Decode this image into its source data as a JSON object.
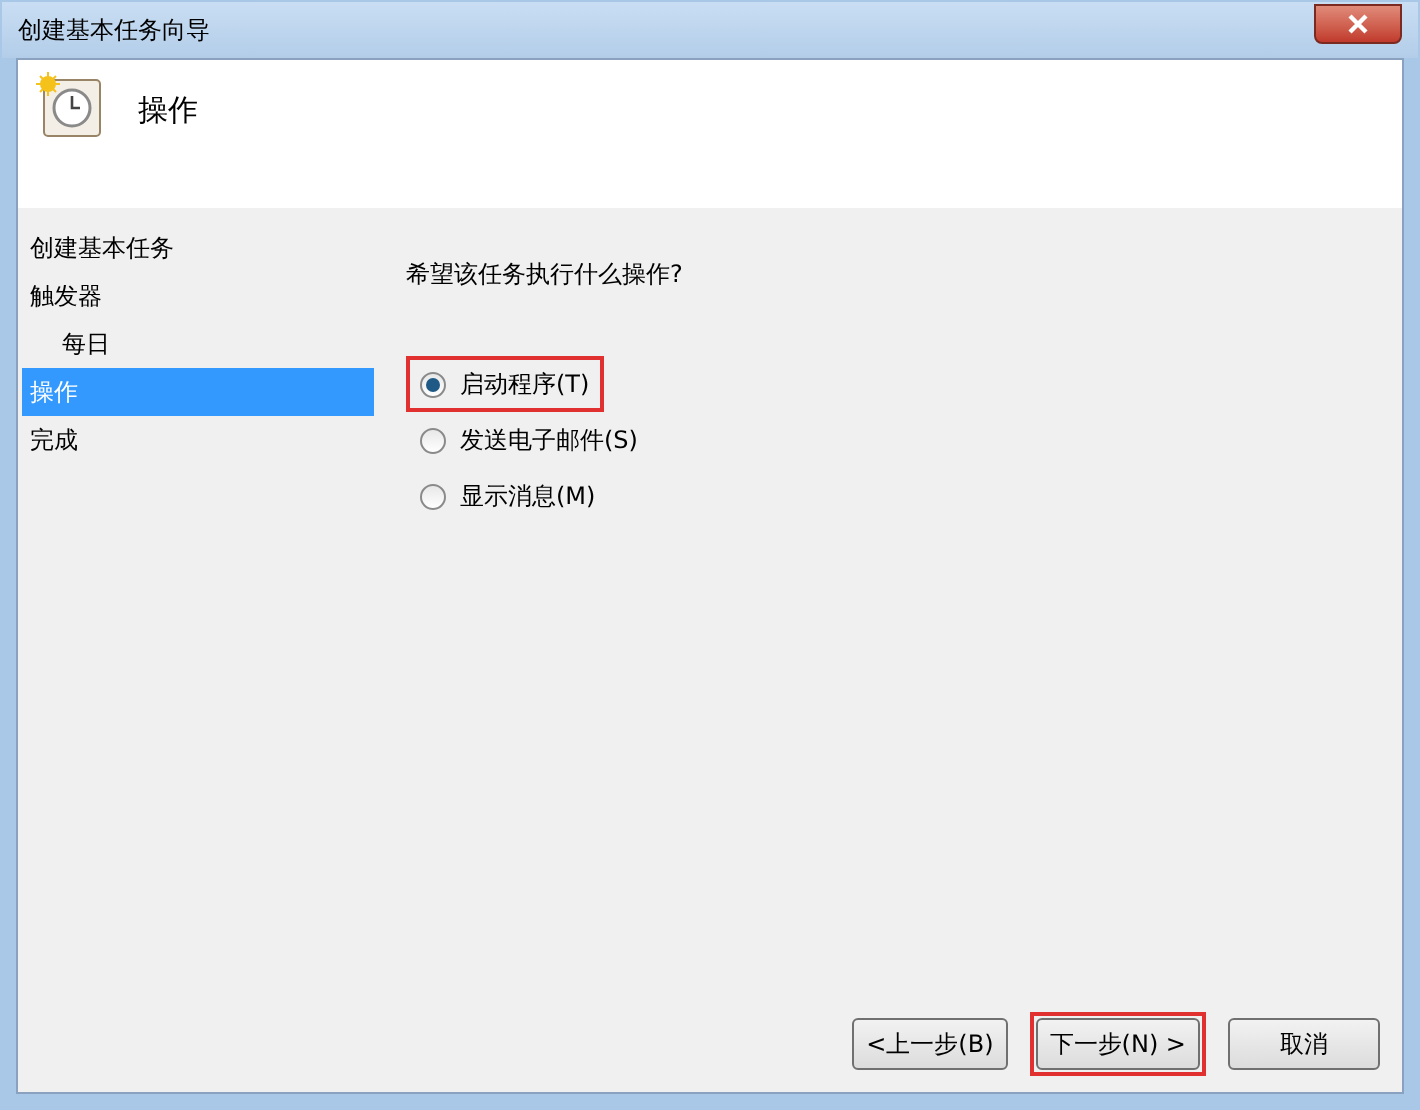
{
  "window": {
    "title": "创建基本任务向导"
  },
  "header": {
    "title": "操作"
  },
  "steps": [
    {
      "label": "创建基本任务",
      "selected": false
    },
    {
      "label": "触发器",
      "selected": false,
      "children": [
        {
          "label": "每日",
          "selected": false
        }
      ]
    },
    {
      "label": "操作",
      "selected": true
    },
    {
      "label": "完成",
      "selected": false
    }
  ],
  "question": "希望该任务执行什么操作?",
  "options": [
    {
      "label": "启动程序(T)",
      "selected": true,
      "highlighted": true
    },
    {
      "label": "发送电子邮件(S)",
      "selected": false,
      "highlighted": false
    },
    {
      "label": "显示消息(M)",
      "selected": false,
      "highlighted": false
    }
  ],
  "buttons": [
    {
      "label": "<上一步(B)",
      "highlighted": false
    },
    {
      "label": "下一步(N) >",
      "highlighted": true
    },
    {
      "label": "取消",
      "highlighted": false
    }
  ]
}
